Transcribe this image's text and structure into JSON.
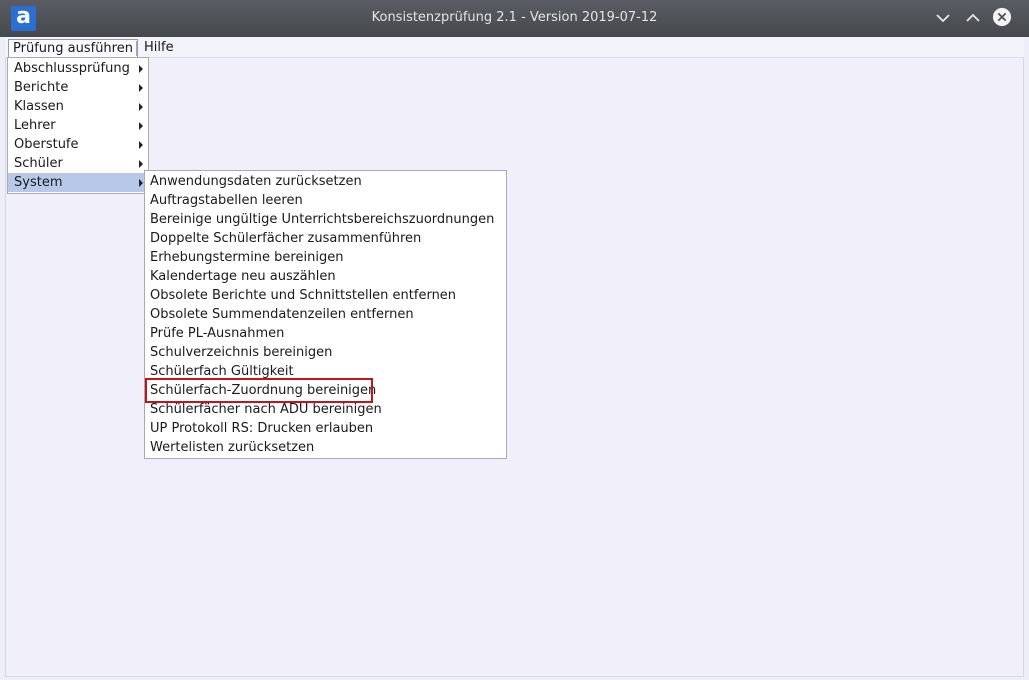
{
  "window": {
    "title": "Konsistenzprüfung 2.1 - Version 2019-07-12",
    "logo_letter": "a",
    "accent_color": "#2a6fd1",
    "controls": [
      "chevron-down-icon",
      "chevron-up-icon",
      "close-icon"
    ]
  },
  "menubar": {
    "items": [
      {
        "label": "Prüfung ausführen",
        "open": true
      },
      {
        "label": "Hilfe"
      }
    ]
  },
  "main_menu": {
    "items": [
      {
        "label": "Abschlussprüfung",
        "has_submenu": true
      },
      {
        "label": "Berichte",
        "has_submenu": true
      },
      {
        "label": "Klassen",
        "has_submenu": true
      },
      {
        "label": "Lehrer",
        "has_submenu": true
      },
      {
        "label": "Oberstufe",
        "has_submenu": true
      },
      {
        "label": "Schüler",
        "has_submenu": true
      },
      {
        "label": "System",
        "has_submenu": true,
        "active": true
      }
    ]
  },
  "system_submenu": {
    "items": [
      {
        "label": "Anwendungsdaten zurücksetzen"
      },
      {
        "label": "Auftragstabellen leeren"
      },
      {
        "label": "Bereinige ungültige Unterrichtsbereichszuordnungen"
      },
      {
        "label": "Doppelte Schülerfächer zusammenführen"
      },
      {
        "label": "Erhebungstermine bereinigen"
      },
      {
        "label": "Kalendertage neu auszählen"
      },
      {
        "label": "Obsolete Berichte und Schnittstellen entfernen"
      },
      {
        "label": "Obsolete Summendatenzeilen entfernen"
      },
      {
        "label": "Prüfe PL-Ausnahmen"
      },
      {
        "label": "Schulverzeichnis bereinigen"
      },
      {
        "label": "Schülerfach Gültigkeit"
      },
      {
        "label": "Schülerfach-Zuordnung bereinigen",
        "highlighted": true
      },
      {
        "label": "Schülerfächer nach ADU bereinigen"
      },
      {
        "label": "UP Protokoll RS: Drucken erlauben"
      },
      {
        "label": "Wertelisten zurücksetzen"
      }
    ],
    "highlight_color": "#c0161b"
  }
}
